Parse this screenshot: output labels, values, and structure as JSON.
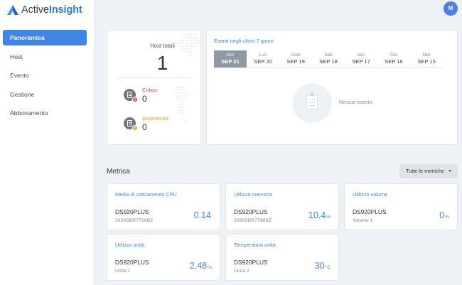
{
  "brand": {
    "name_prefix": "Active",
    "name_suffix": "Insight"
  },
  "sidebar": {
    "items": [
      {
        "label": "Panoramica",
        "active": true
      },
      {
        "label": "Host"
      },
      {
        "label": "Evento"
      },
      {
        "label": "Gestione"
      },
      {
        "label": "Abbonamento"
      }
    ]
  },
  "user": {
    "initial": "M"
  },
  "hosts": {
    "label": "Host totali",
    "count": "1",
    "critical": {
      "label": "Critico",
      "count": "0"
    },
    "warning": {
      "label": "Avvertenza",
      "count": "0"
    }
  },
  "events": {
    "title": "Eventi negli ultimi 7 giorni",
    "days": [
      {
        "day": "Mar",
        "date": "SEP 21",
        "active": true
      },
      {
        "day": "Lun",
        "date": "SEP 20"
      },
      {
        "day": "Dom",
        "date": "SEP 19"
      },
      {
        "day": "Sab",
        "date": "SEP 18"
      },
      {
        "day": "Ven",
        "date": "SEP 17"
      },
      {
        "day": "Gio",
        "date": "SEP 16"
      },
      {
        "day": "Mer",
        "date": "SEP 15"
      }
    ],
    "empty_text": "Nessun evento"
  },
  "metrics": {
    "title": "Metrica",
    "filter_label": "Tutte le metriche",
    "cards": [
      {
        "title": "Media di caricamento CPU",
        "device": "DS920PLUS",
        "sub": "2030SBR7T68BZ",
        "value": "0.14",
        "unit": ""
      },
      {
        "title": "Utilizzo memoria",
        "device": "DS920PLUS",
        "sub": "2030SBR7T68BZ",
        "value": "10.4",
        "unit": "%"
      },
      {
        "title": "Utilizzo volume",
        "device": "DS920PLUS",
        "sub": "Volume 1",
        "value": "0",
        "unit": "%"
      },
      {
        "title": "Utilizzo unità",
        "device": "DS920PLUS",
        "sub": "Unità 1",
        "value": "2.48",
        "unit": "%"
      },
      {
        "title": "Temperatura unità",
        "device": "DS920PLUS",
        "sub": "Unità 2",
        "value": "30",
        "unit": "°C"
      }
    ]
  },
  "colors": {
    "accent": "#3f86e8",
    "critical": "#e84a4a",
    "warning": "#f29a2e"
  }
}
